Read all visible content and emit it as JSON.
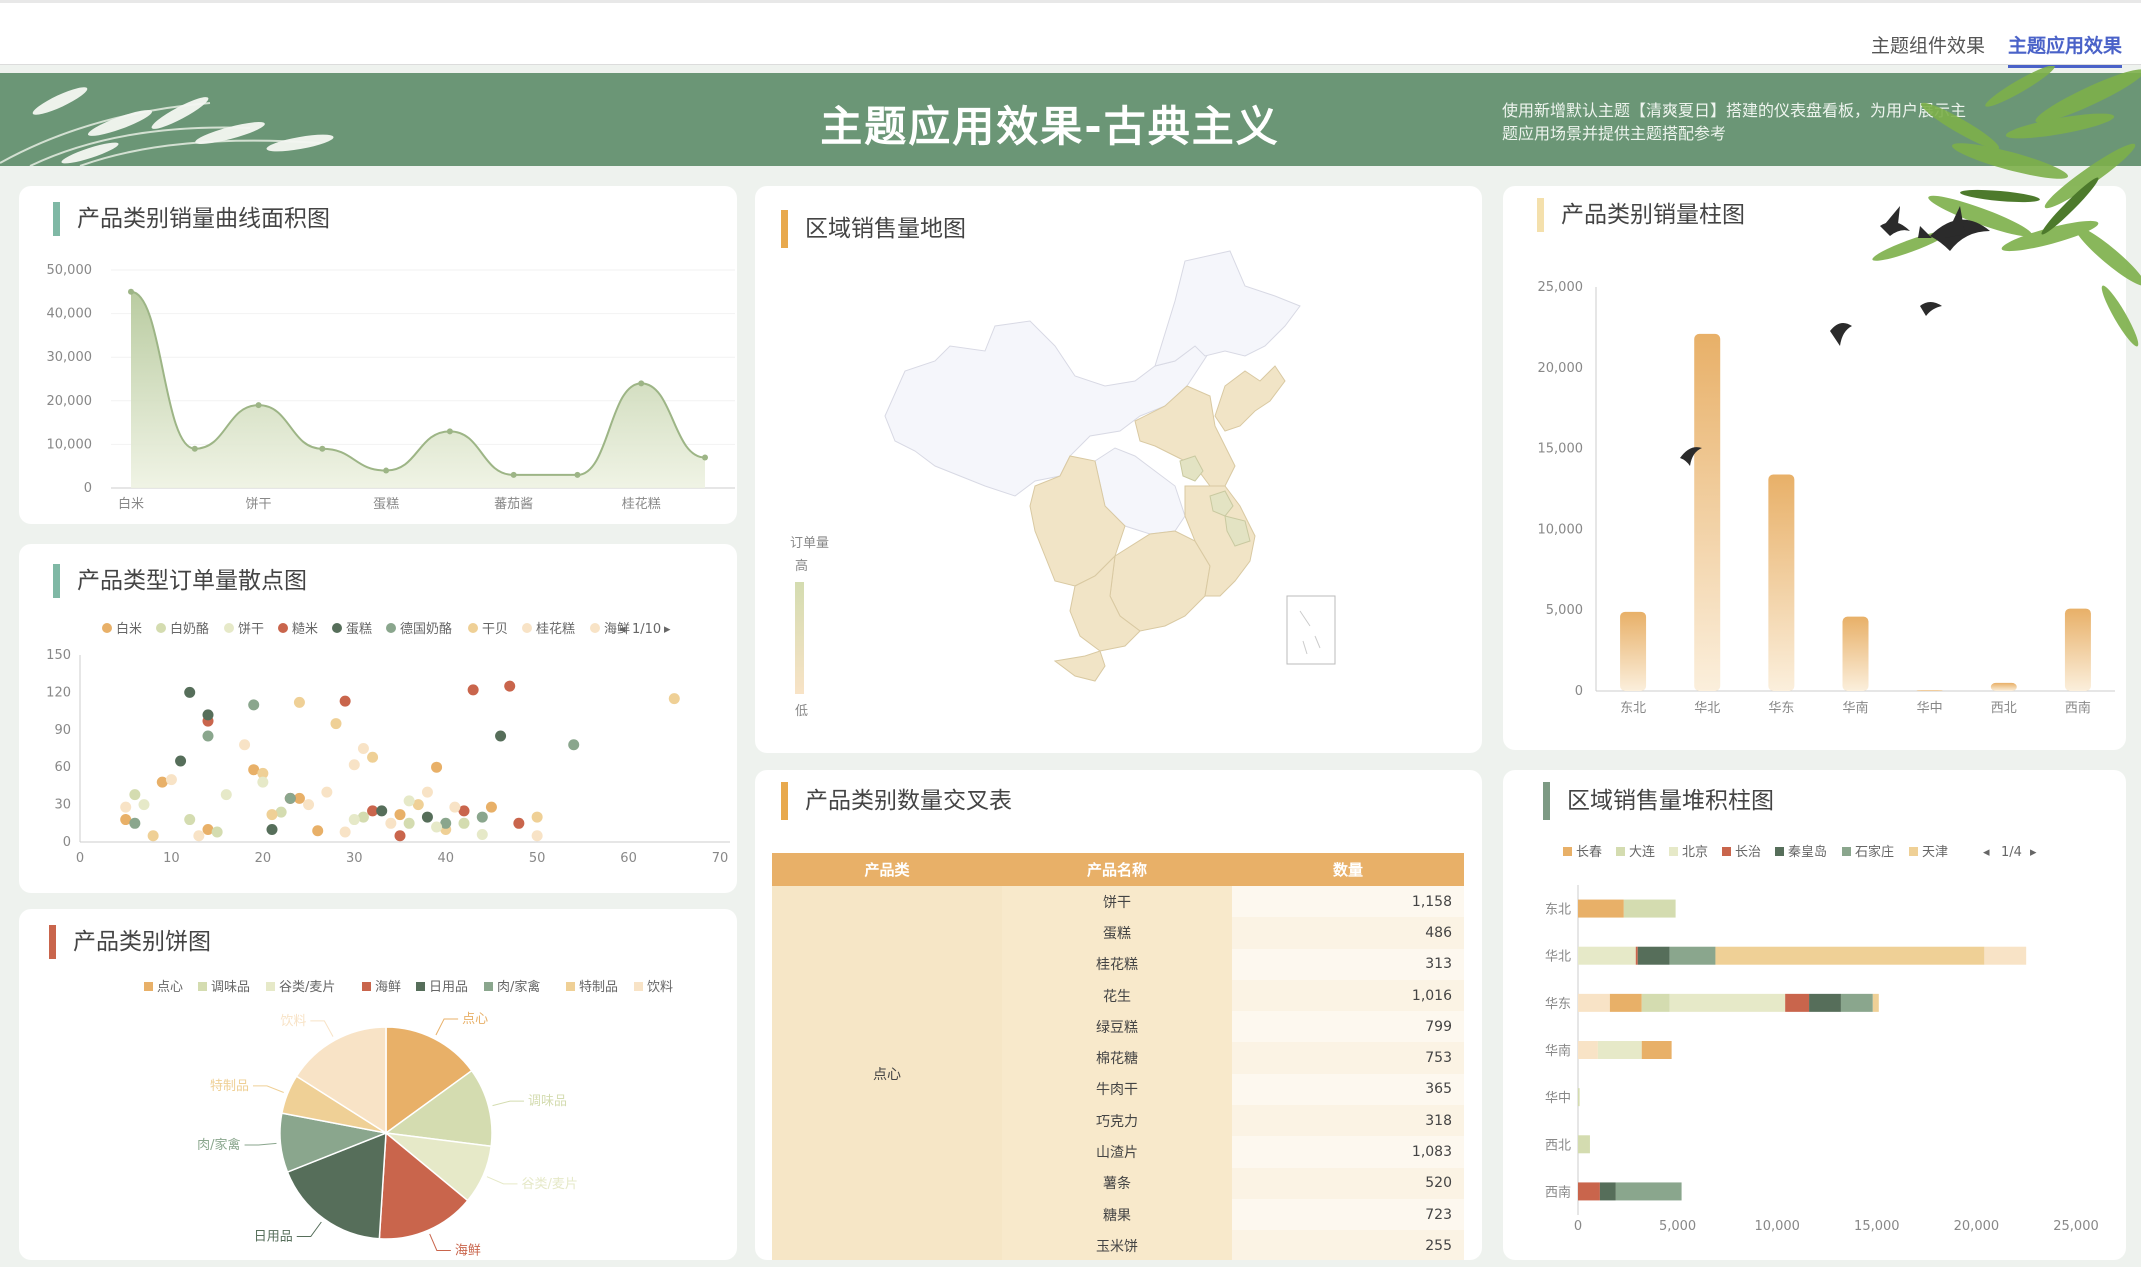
{
  "tabs": [
    {
      "label": "主题组件效果",
      "active": false
    },
    {
      "label": "主题应用效果",
      "active": true
    }
  ],
  "banner": {
    "title": "主题应用效果-古典主义",
    "description": "使用新增默认主题【清爽夏日】搭建的仪表盘看板，为用户展示主题应用场景并提供主题搭配参考"
  },
  "colors": {
    "palette": [
      "#e8b068",
      "#d4dcb0",
      "#e6e9c8",
      "#c9654c",
      "#566e5a",
      "#8aa68d",
      "#efd096",
      "#f8e3c6"
    ]
  },
  "panels": {
    "area": "产品类别销量曲线面积图",
    "scatter": "产品类型订单量散点图",
    "pie": "产品类别饼图",
    "map": "区域销售量地图",
    "table": "产品类别数量交叉表",
    "bar": "产品类别销量柱图",
    "stack": "区域销售量堆积柱图"
  },
  "map_legend": {
    "title": "订单量",
    "high": "高",
    "low": "低"
  },
  "chart_data": [
    {
      "id": "area",
      "type": "area",
      "x": [
        "白米",
        "",
        "饼干",
        "",
        "蛋糕",
        "",
        "蕃茄酱",
        "",
        "桂花糕",
        ""
      ],
      "values": [
        45000,
        9000,
        19000,
        9000,
        4000,
        13000,
        3000,
        3000,
        24000,
        7000
      ],
      "x_tick_labels": [
        "白米",
        "饼干",
        "蛋糕",
        "蕃茄酱",
        "桂花糕"
      ],
      "y_ticks": [
        "0",
        "10,000",
        "20,000",
        "30,000",
        "40,000",
        "50,000"
      ],
      "ylim": [
        0,
        50000
      ]
    },
    {
      "id": "scatter",
      "type": "scatter",
      "legend": [
        "白米",
        "白奶酪",
        "饼干",
        "糙米",
        "蛋糕",
        "德国奶酪",
        "干贝",
        "桂花糕",
        "海鲜"
      ],
      "legend_page": "1/10",
      "x_ticks": [
        "0",
        "10",
        "20",
        "30",
        "40",
        "50",
        "60",
        "70"
      ],
      "y_ticks": [
        "0",
        "30",
        "60",
        "90",
        "120",
        "150"
      ],
      "xlim": [
        0,
        70
      ],
      "ylim": [
        0,
        150
      ],
      "series": [
        {
          "name": "白米",
          "points": [
            [
              5,
              18
            ],
            [
              9,
              48
            ],
            [
              14,
              10
            ],
            [
              19,
              58
            ],
            [
              24,
              35
            ],
            [
              35,
              22
            ],
            [
              45,
              28
            ],
            [
              26,
              9
            ],
            [
              39,
              60
            ]
          ]
        },
        {
          "name": "白奶酪",
          "points": [
            [
              6,
              38
            ],
            [
              15,
              8
            ],
            [
              22,
              24
            ],
            [
              31,
              20
            ],
            [
              42,
              15
            ],
            [
              12,
              18
            ],
            [
              36,
              15
            ]
          ]
        },
        {
          "name": "饼干",
          "points": [
            [
              8,
              5
            ],
            [
              20,
              55
            ],
            [
              24,
              112
            ],
            [
              28,
              95
            ],
            [
              32,
              68
            ],
            [
              40,
              10
            ],
            [
              50,
              20
            ],
            [
              65,
              115
            ],
            [
              37,
              30
            ],
            [
              21,
              22
            ]
          ]
        },
        {
          "name": "糙米",
          "points": [
            [
              14,
              97
            ],
            [
              23,
              35
            ],
            [
              29,
              113
            ],
            [
              35,
              5
            ],
            [
              43,
              122
            ],
            [
              47,
              125
            ],
            [
              48,
              15
            ],
            [
              32,
              25
            ],
            [
              42,
              25
            ]
          ]
        },
        {
          "name": "蛋糕",
          "points": [
            [
              11,
              65
            ],
            [
              12,
              120
            ],
            [
              14,
              102
            ],
            [
              21,
              10
            ],
            [
              33,
              25
            ],
            [
              38,
              20
            ],
            [
              46,
              85
            ]
          ]
        },
        {
          "name": "德国奶酪",
          "points": [
            [
              6,
              15
            ],
            [
              14,
              85
            ],
            [
              19,
              110
            ],
            [
              23,
              35
            ],
            [
              40,
              15
            ],
            [
              54,
              78
            ],
            [
              44,
              20
            ]
          ]
        },
        {
          "name": "干贝",
          "points": [
            [
              10,
              50
            ],
            [
              18,
              78
            ],
            [
              27,
              40
            ],
            [
              31,
              75
            ],
            [
              41,
              28
            ],
            [
              29,
              8
            ],
            [
              50,
              5
            ]
          ]
        },
        {
          "name": "桂花糕",
          "points": [
            [
              7,
              30
            ],
            [
              16,
              38
            ],
            [
              20,
              48
            ],
            [
              30,
              18
            ],
            [
              39,
              12
            ],
            [
              44,
              6
            ],
            [
              36,
              33
            ]
          ]
        },
        {
          "name": "海鲜",
          "points": [
            [
              5,
              28
            ],
            [
              13,
              5
            ],
            [
              25,
              30
            ],
            [
              34,
              15
            ],
            [
              30,
              62
            ],
            [
              38,
              40
            ]
          ]
        }
      ]
    },
    {
      "id": "pie",
      "type": "pie",
      "legend": [
        "点心",
        "调味品",
        "谷类/麦片",
        "海鲜",
        "日用品",
        "肉/家禽",
        "特制品",
        "饮料"
      ],
      "slices": [
        {
          "label": "点心",
          "value": 15
        },
        {
          "label": "调味品",
          "value": 12
        },
        {
          "label": "谷类/麦片",
          "value": 9
        },
        {
          "label": "海鲜",
          "value": 15
        },
        {
          "label": "日用品",
          "value": 18
        },
        {
          "label": "肉/家禽",
          "value": 9
        },
        {
          "label": "特制品",
          "value": 6
        },
        {
          "label": "饮料",
          "value": 16
        }
      ]
    },
    {
      "id": "bar",
      "type": "bar",
      "categories": [
        "东北",
        "华北",
        "华东",
        "华南",
        "华中",
        "西北",
        "西南"
      ],
      "values": [
        4900,
        22100,
        13400,
        4600,
        60,
        500,
        5100
      ],
      "y_ticks": [
        "0",
        "5,000",
        "10,000",
        "15,000",
        "20,000",
        "25,000"
      ],
      "ylim": [
        0,
        25000
      ]
    },
    {
      "id": "stack",
      "type": "bar",
      "orientation": "horizontal",
      "stacked": true,
      "categories": [
        "东北",
        "华北",
        "华东",
        "华南",
        "华中",
        "西北",
        "西南"
      ],
      "legend": [
        "长春",
        "大连",
        "北京",
        "长治",
        "秦皇岛",
        "石家庄",
        "天津"
      ],
      "legend_page": "1/4",
      "x_ticks": [
        "0",
        "5,000",
        "10,000",
        "15,000",
        "20,000",
        "25,000"
      ],
      "xlim": [
        0,
        25000
      ],
      "rows": [
        [
          {
            "v": 2300,
            "c": 0
          },
          {
            "v": 2600,
            "c": 1
          }
        ],
        [
          {
            "v": 2900,
            "c": 2
          },
          {
            "v": 100,
            "c": 3
          },
          {
            "v": 1600,
            "c": 4
          },
          {
            "v": 2300,
            "c": 5
          },
          {
            "v": 13500,
            "c": 6
          },
          {
            "v": 2100,
            "c": 7
          }
        ],
        [
          {
            "v": 1600,
            "c": 7
          },
          {
            "v": 1600,
            "c": 0
          },
          {
            "v": 1400,
            "c": 1
          },
          {
            "v": 5800,
            "c": 2
          },
          {
            "v": 1200,
            "c": 3
          },
          {
            "v": 1600,
            "c": 4
          },
          {
            "v": 1600,
            "c": 5
          },
          {
            "v": 300,
            "c": 6
          }
        ],
        [
          {
            "v": 1000,
            "c": 7
          },
          {
            "v": 2200,
            "c": 2
          },
          {
            "v": 1500,
            "c": 0
          }
        ],
        [
          {
            "v": 80,
            "c": 1
          }
        ],
        [
          {
            "v": 600,
            "c": 1
          }
        ],
        [
          {
            "v": 1100,
            "c": 3
          },
          {
            "v": 800,
            "c": 4
          },
          {
            "v": 3300,
            "c": 5
          }
        ]
      ]
    }
  ],
  "cross_table": {
    "headers": [
      "产品类",
      "产品名称",
      "数量"
    ],
    "category": "点心",
    "rows": [
      [
        "饼干",
        "1,158"
      ],
      [
        "蛋糕",
        "486"
      ],
      [
        "桂花糕",
        "313"
      ],
      [
        "花生",
        "1,016"
      ],
      [
        "绿豆糕",
        "799"
      ],
      [
        "棉花糖",
        "753"
      ],
      [
        "牛肉干",
        "365"
      ],
      [
        "巧克力",
        "318"
      ],
      [
        "山渣片",
        "1,083"
      ],
      [
        "薯条",
        "520"
      ],
      [
        "糖果",
        "723"
      ],
      [
        "玉米饼",
        "255"
      ]
    ]
  }
}
